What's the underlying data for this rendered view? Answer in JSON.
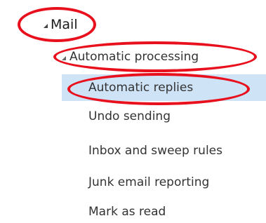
{
  "tree": {
    "root": {
      "label": "Mail",
      "expanded": true
    },
    "group": {
      "label": "Automatic processing",
      "expanded": true
    },
    "items": [
      {
        "label": "Automatic replies",
        "selected": true
      },
      {
        "label": "Undo sending",
        "selected": false
      },
      {
        "label": "Inbox and sweep rules",
        "selected": false
      },
      {
        "label": "Junk email reporting",
        "selected": false
      },
      {
        "label": "Mark as read",
        "selected": false
      }
    ]
  },
  "colors": {
    "selection_background": "#cfe3f7",
    "annotation_red": "#e8101c",
    "text": "#333333"
  },
  "icons": {
    "expand_indicator": "triangle-expanded-icon"
  }
}
